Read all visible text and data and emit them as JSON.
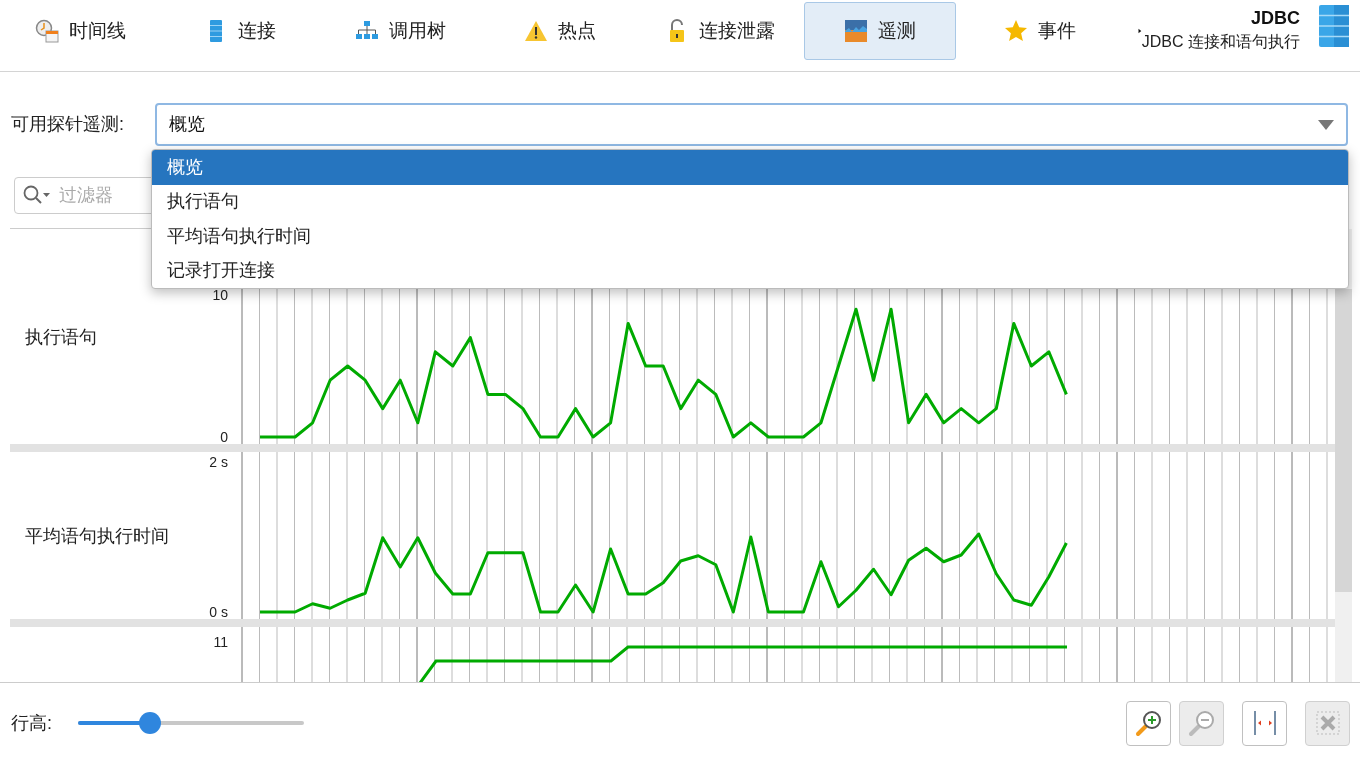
{
  "toolbar": {
    "tabs": [
      {
        "label": "时间线",
        "selected": false
      },
      {
        "label": "连接",
        "selected": false
      },
      {
        "label": "调用树",
        "selected": false
      },
      {
        "label": "热点",
        "selected": false
      },
      {
        "label": "连接泄露",
        "selected": false
      },
      {
        "label": "遥测",
        "selected": true
      },
      {
        "label": "事件",
        "selected": false
      }
    ],
    "section": {
      "title": "JDBC",
      "subtitle": "JDBC 连接和语句执行"
    }
  },
  "probe_select": {
    "label": "可用探针遥测:",
    "value": "概览",
    "expanded": true,
    "options": [
      {
        "label": "概览",
        "selected": true
      },
      {
        "label": "执行语句",
        "selected": false
      },
      {
        "label": "平均语句执行时间",
        "selected": false
      },
      {
        "label": "记录打开连接",
        "selected": false
      }
    ]
  },
  "filter": {
    "placeholder": "过滤器"
  },
  "telemetries": [
    {
      "name": "执行语句",
      "chart_data": {
        "type": "line",
        "grid": true,
        "ylim": [
          0,
          10
        ],
        "yticks": [
          {
            "value": 0,
            "label": "0"
          },
          {
            "value": 10,
            "label": "10"
          }
        ],
        "series": [
          {
            "color": "#00aa00",
            "values": [
              0,
              0,
              0,
              1,
              4,
              5,
              4,
              2,
              4,
              1,
              6,
              5,
              7,
              3,
              3,
              2,
              0,
              0,
              2,
              0,
              1,
              8,
              5,
              5,
              2,
              4,
              3,
              0,
              1,
              0,
              0,
              0,
              1,
              5,
              9,
              4,
              9,
              1,
              3,
              1,
              2,
              1,
              2,
              8,
              5,
              6,
              3
            ]
          }
        ]
      }
    },
    {
      "name": "平均语句执行时间",
      "chart_data": {
        "type": "line",
        "grid": true,
        "ylim": [
          0,
          2
        ],
        "yticks": [
          {
            "value": 0,
            "label": "0 s"
          },
          {
            "value": 2,
            "label": "2 s"
          }
        ],
        "series": [
          {
            "color": "#00aa00",
            "values": [
              0,
              0,
              0,
              0.11,
              0.05,
              0.16,
              0.25,
              0.99,
              0.6,
              0.99,
              0.52,
              0.24,
              0.24,
              0.79,
              0.79,
              0.79,
              0,
              0,
              0.36,
              0,
              0.84,
              0.24,
              0.24,
              0.39,
              0.68,
              0.75,
              0.63,
              0,
              1.0,
              0,
              0,
              0,
              0.67,
              0.07,
              0.29,
              0.57,
              0.23,
              0.69,
              0.85,
              0.67,
              0.76,
              1.04,
              0.51,
              0.16,
              0.09,
              0.47,
              0.92
            ]
          }
        ]
      }
    }
  ],
  "partial_row": {
    "tick": "11"
  },
  "row_height": {
    "label": "行高:",
    "level": 0.32
  },
  "buttons": [
    {
      "disabled": false
    },
    {
      "disabled": true
    },
    {
      "disabled": false
    },
    {
      "disabled": true
    }
  ]
}
